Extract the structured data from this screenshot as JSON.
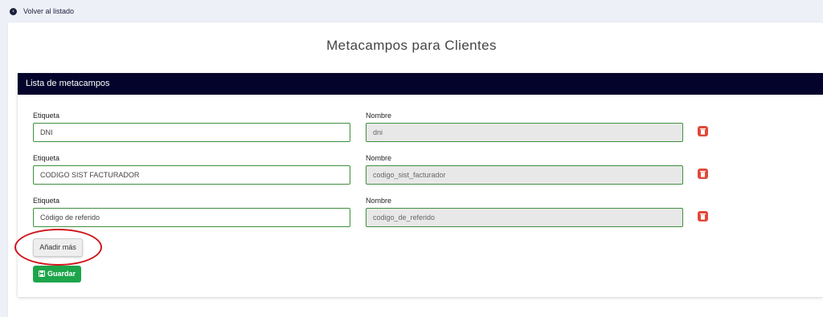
{
  "nav": {
    "back_label": "Volver al listado"
  },
  "page": {
    "title": "Metacampos para Clientes"
  },
  "card": {
    "header": "Lista de metacampos"
  },
  "rows": [
    {
      "label_etiqueta": "Etiqueta",
      "etiqueta": "DNI",
      "label_nombre": "Nombre",
      "nombre": "dni"
    },
    {
      "label_etiqueta": "Etiqueta",
      "etiqueta": "CODIGO SIST FACTURADOR",
      "label_nombre": "Nombre",
      "nombre": "codigo_sist_facturador"
    },
    {
      "label_etiqueta": "Etiqueta",
      "etiqueta": "Código de referido",
      "label_nombre": "Nombre",
      "nombre": "codigo_de_referido"
    }
  ],
  "actions": {
    "add_label": "Añadir más",
    "save_label": "Guardar"
  },
  "colors": {
    "header_bg": "#03032b",
    "field_border": "#3f8f3f",
    "delete": "#e04a3a",
    "save": "#1da54a",
    "highlight": "#d0141b"
  },
  "icons": {
    "back": "chevron-left-circle-icon",
    "delete": "trash-icon",
    "save": "floppy-disk-icon"
  }
}
